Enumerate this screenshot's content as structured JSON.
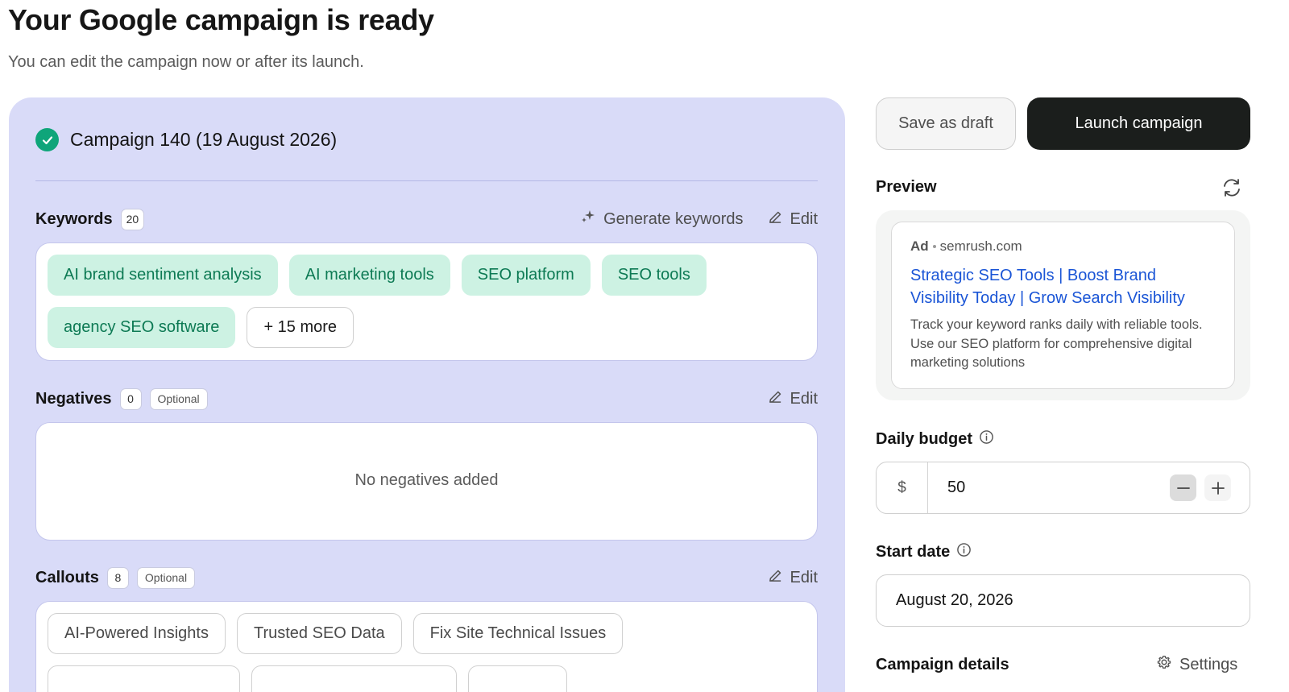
{
  "header": {
    "title": "Your Google campaign is ready",
    "subtitle": "You can edit the campaign now or after its launch."
  },
  "campaign": {
    "name": "Campaign 140 (19 August 2026)"
  },
  "keywords": {
    "title": "Keywords",
    "count": "20",
    "generate_label": "Generate keywords",
    "edit_label": "Edit",
    "chips": [
      "AI brand sentiment analysis",
      "AI marketing tools",
      "SEO platform",
      "SEO tools",
      "agency SEO software"
    ],
    "more_label": "+ 15 more"
  },
  "negatives": {
    "title": "Negatives",
    "count": "0",
    "optional_label": "Optional",
    "edit_label": "Edit",
    "empty_text": "No negatives added"
  },
  "callouts": {
    "title": "Callouts",
    "count": "8",
    "optional_label": "Optional",
    "edit_label": "Edit",
    "chips": [
      "AI-Powered Insights",
      "Trusted SEO Data",
      "Fix Site Technical Issues"
    ]
  },
  "actions": {
    "save_draft": "Save as draft",
    "launch": "Launch campaign"
  },
  "preview": {
    "label": "Preview",
    "ad_tag": "Ad",
    "domain": "semrush.com",
    "headline": "Strategic SEO Tools | Boost Brand Visibility Today | Grow Search Visibility",
    "description": "Track your keyword ranks daily with reliable tools. Use our SEO platform for comprehensive digital marketing solutions"
  },
  "budget": {
    "label": "Daily budget",
    "currency": "$",
    "value": "50"
  },
  "start_date": {
    "label": "Start date",
    "value": "August 20, 2026"
  },
  "details": {
    "label": "Campaign details",
    "settings_label": "Settings"
  },
  "colors": {
    "panel_bg": "#d9dbf8",
    "keyword_chip_bg": "#cdf2e3",
    "keyword_chip_text": "#0d7a54",
    "ad_headline": "#1a55d6",
    "launch_bg": "#1b1e1c",
    "check_green": "#0fa57a"
  },
  "icons": {
    "campaign_status": "check-circle-icon",
    "generate": "sparkle-icon",
    "edit": "pencil-icon",
    "refresh": "refresh-icon",
    "info": "info-icon",
    "minus": "minus-icon",
    "plus": "plus-icon",
    "settings": "gear-icon"
  }
}
